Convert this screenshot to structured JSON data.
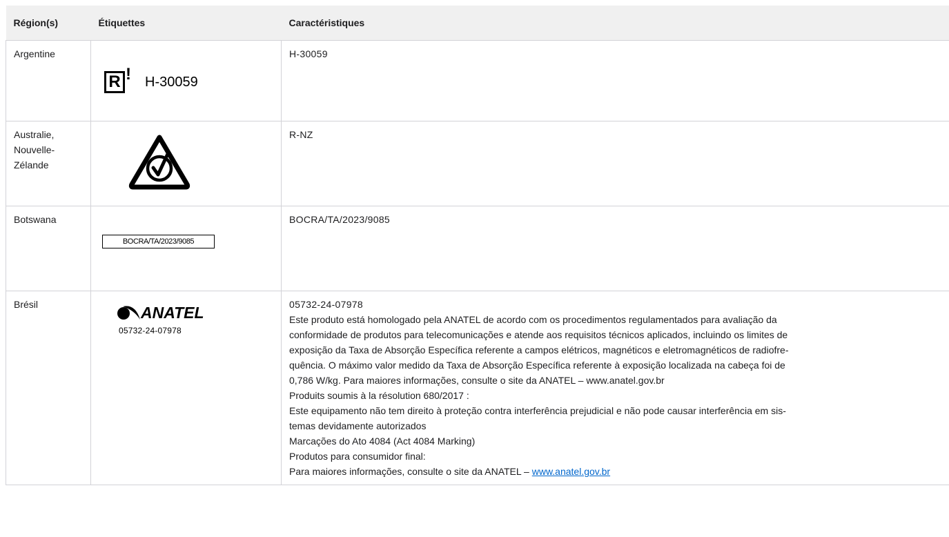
{
  "table": {
    "headers": [
      "Région(s)",
      "Étiquettes",
      "Caractéristiques"
    ],
    "rows": [
      {
        "region": "Argentine",
        "label": {
          "number": "H-30059"
        },
        "spec": [
          "H-30059"
        ]
      },
      {
        "region": "Australie, Nouvelle-Zélande",
        "region_lines": [
          "Australie,",
          "Nouvelle-",
          "Zélande"
        ],
        "label": {
          "icon": "rcm-compliance-mark-icon"
        },
        "spec": [
          "R-NZ"
        ]
      },
      {
        "region": "Botswana",
        "label": {
          "text": "BOCRA/TA/2023/9085"
        },
        "spec": [
          "BOCRA/TA/2023/9085"
        ]
      },
      {
        "region": "Brésil",
        "label": {
          "logo_text": "ANATEL",
          "number": "05732-24-07978"
        },
        "spec": [
          "05732-24-07978",
          "Este produto está homologado pela ANATEL de acordo com os procedimentos regulamentados para avaliação da",
          "conformidade de produtos para telecomunicações e atende aos requisitos técnicos aplicados, incluindo os limites de",
          "exposição da Taxa de Absorção Específica referente a campos elétricos, magnéticos e eletromagnéticos de radiofre-",
          "quência. O máximo valor medido da Taxa de Absorção Específica referente à exposição localizada na cabeça foi de",
          "0,786 W/kg. Para maiores informações, consulte o site da ANATEL – www.anatel.gov.br",
          "Produits soumis à la résolution 680/2017 :",
          "Este equipamento não tem direito à proteção contra interferência prejudicial e não pode causar interferência em sis-",
          "temas devidamente autorizados",
          "Marcações do Ato 4084 (Act 4084 Marking)",
          "Produtos para consumidor final:"
        ],
        "spec_last_prefix": "Para maiores informações, consulte o site da ANATEL – ",
        "spec_last_link": "www.anatel.gov.br"
      }
    ]
  },
  "colors": {
    "header_bg": "#f0f0f0",
    "border": "#d2d2d7",
    "link": "#0066cc",
    "text": "#1d1d1f"
  }
}
